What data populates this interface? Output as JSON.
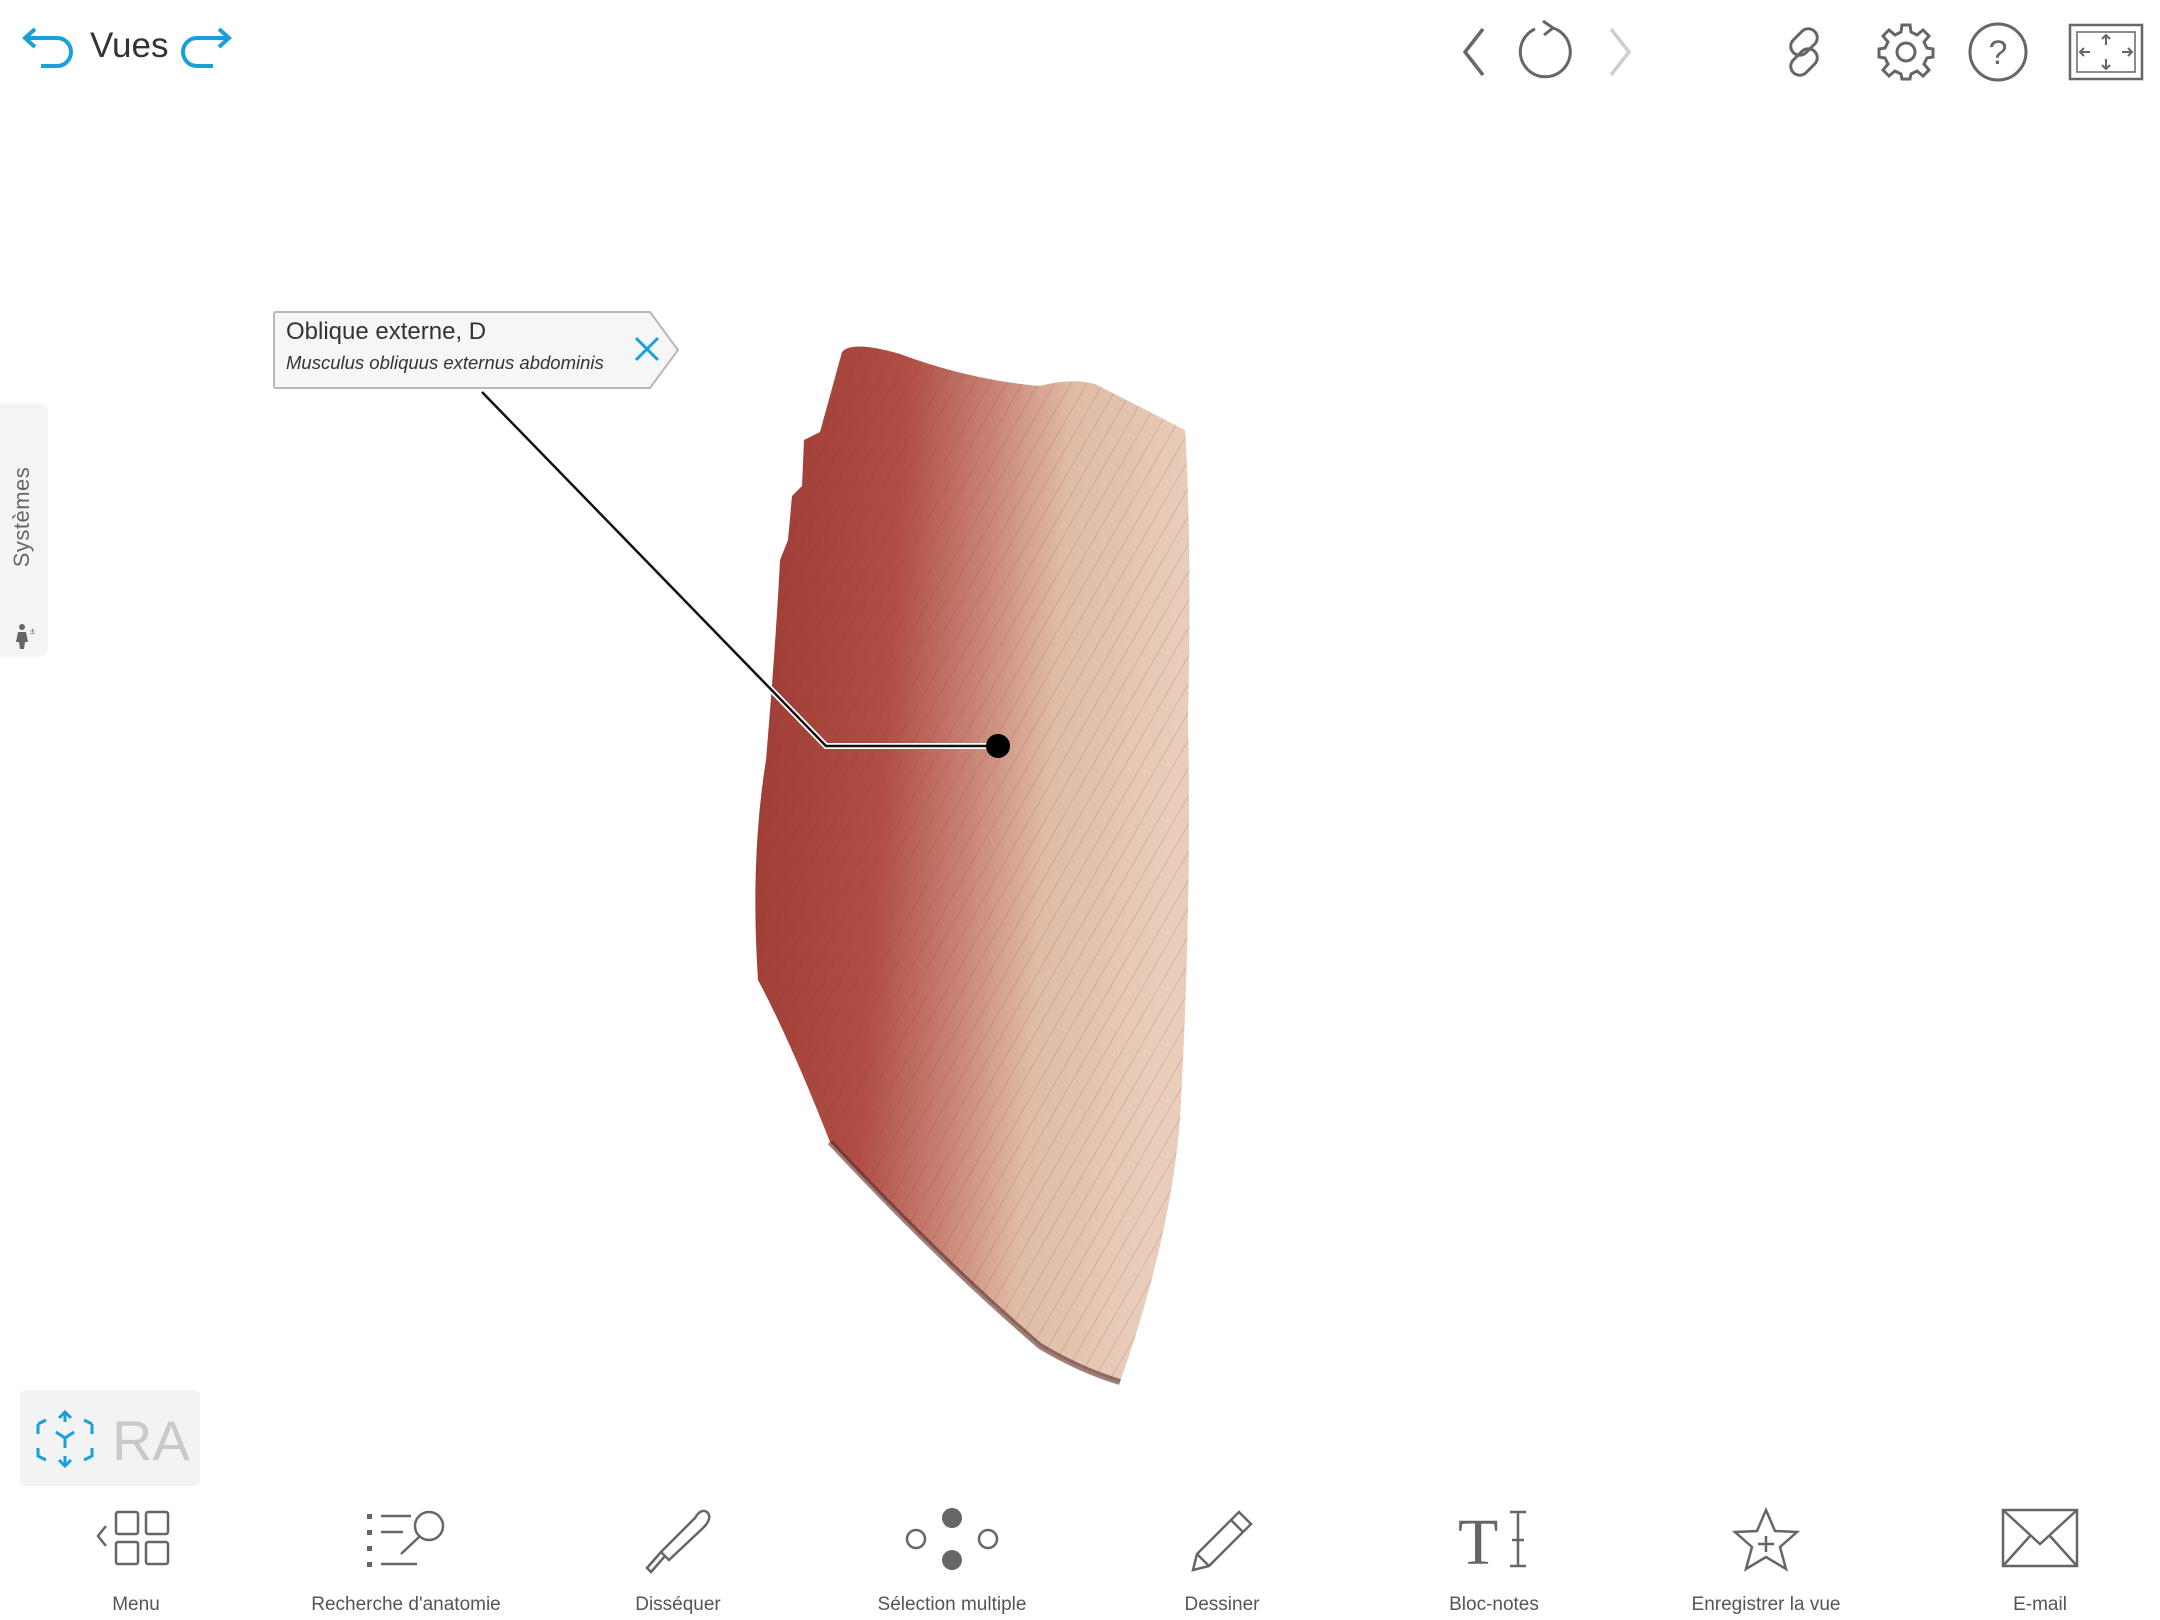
{
  "header": {
    "views_label": "Vues",
    "icons": {
      "undo": "undo-arrow-icon",
      "redo": "redo-arrow-icon",
      "back": "chevron-left-icon",
      "reset": "reset-rotate-icon",
      "forward": "chevron-right-icon",
      "link": "link-icon",
      "settings": "gear-icon",
      "help": "help-icon",
      "fullscreen": "fullscreen-icon"
    }
  },
  "side_panel": {
    "label": "Systèmes",
    "icon": "body-systems-icon"
  },
  "label_callout": {
    "title": "Oblique externe, D",
    "latin": "Musculus obliquus externus abdominis",
    "close_icon": "close-icon"
  },
  "ar_button": {
    "label": "RA",
    "icon": "ar-cube-icon"
  },
  "toolbar": {
    "items": [
      {
        "label": "Menu",
        "icon": "menu-grid-icon"
      },
      {
        "label": "Recherche d'anatomie",
        "icon": "anatomy-search-icon"
      },
      {
        "label": "Disséquer",
        "icon": "scalpel-icon"
      },
      {
        "label": "Sélection multiple",
        "icon": "multi-select-icon"
      },
      {
        "label": "Dessiner",
        "icon": "pencil-icon"
      },
      {
        "label": "Bloc-notes",
        "icon": "text-notes-icon"
      },
      {
        "label": "Enregistrer la vue",
        "icon": "save-view-star-icon"
      },
      {
        "label": "E-mail",
        "icon": "envelope-icon"
      }
    ]
  },
  "colors": {
    "accent": "#1aa0d8",
    "icon_gray": "#666666",
    "muscle_red": "#a8463f",
    "tendon_pale": "#e3c6b2"
  }
}
